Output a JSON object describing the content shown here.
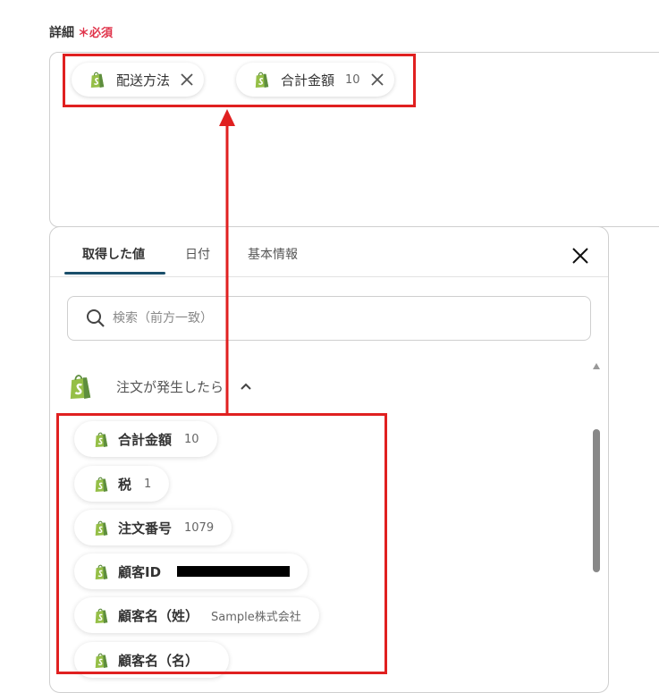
{
  "field": {
    "label": "詳細",
    "required_mark": "＊必須"
  },
  "selected_tokens": [
    {
      "label": "配送方法",
      "value": "",
      "icon": "shopify-icon"
    },
    {
      "label": "合計金額",
      "value": "10",
      "icon": "shopify-icon"
    }
  ],
  "picker": {
    "tabs": [
      {
        "label": "取得した値",
        "active": true
      },
      {
        "label": "日付",
        "active": false
      },
      {
        "label": "基本情報",
        "active": false
      }
    ],
    "search": {
      "placeholder": "検索（前方一致）",
      "value": ""
    },
    "section": {
      "title": "注文が発生したら",
      "expanded": true
    },
    "items": [
      {
        "label": "合計金額",
        "value": "10"
      },
      {
        "label": "税",
        "value": "1"
      },
      {
        "label": "注文番号",
        "value": "1079"
      },
      {
        "label": "顧客ID",
        "value": "",
        "redacted": true
      },
      {
        "label": "顧客名（姓）",
        "value": "Sample株式会社"
      },
      {
        "label": "顧客名（名）",
        "value": ""
      }
    ]
  },
  "colors": {
    "accent": "#1b4f6b",
    "required": "#e0334a",
    "annotation": "#e02020",
    "shopify": "#95bf47"
  }
}
